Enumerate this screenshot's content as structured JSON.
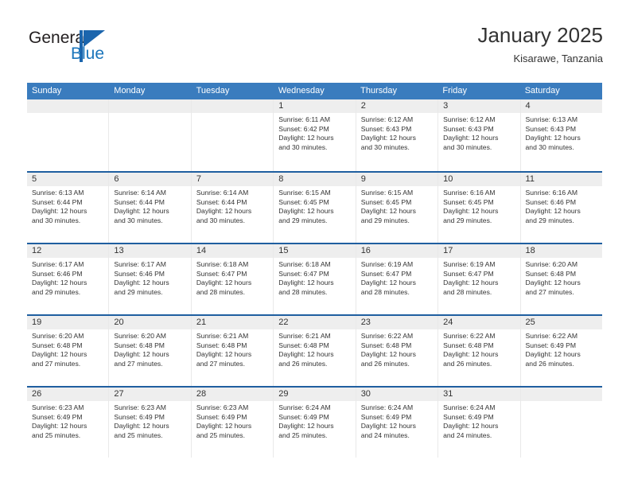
{
  "brand": {
    "name_part1": "General",
    "name_part2": "Blue",
    "flag_icon": "triangle-flag-icon"
  },
  "header": {
    "month_title": "January 2025",
    "location": "Kisarawe, Tanzania"
  },
  "calendar": {
    "weekday_headers": [
      "Sunday",
      "Monday",
      "Tuesday",
      "Wednesday",
      "Thursday",
      "Friday",
      "Saturday"
    ],
    "accent_color": "#3a7cbe",
    "row_divider_color": "#1f5fa0",
    "day_band_color": "#eeeeee",
    "weeks": [
      [
        {
          "day": "",
          "empty": true
        },
        {
          "day": "",
          "empty": true
        },
        {
          "day": "",
          "empty": true
        },
        {
          "day": "1",
          "sunrise": "Sunrise: 6:11 AM",
          "sunset": "Sunset: 6:42 PM",
          "daylight_line1": "Daylight: 12 hours",
          "daylight_line2": "and 30 minutes."
        },
        {
          "day": "2",
          "sunrise": "Sunrise: 6:12 AM",
          "sunset": "Sunset: 6:43 PM",
          "daylight_line1": "Daylight: 12 hours",
          "daylight_line2": "and 30 minutes."
        },
        {
          "day": "3",
          "sunrise": "Sunrise: 6:12 AM",
          "sunset": "Sunset: 6:43 PM",
          "daylight_line1": "Daylight: 12 hours",
          "daylight_line2": "and 30 minutes."
        },
        {
          "day": "4",
          "sunrise": "Sunrise: 6:13 AM",
          "sunset": "Sunset: 6:43 PM",
          "daylight_line1": "Daylight: 12 hours",
          "daylight_line2": "and 30 minutes."
        }
      ],
      [
        {
          "day": "5",
          "sunrise": "Sunrise: 6:13 AM",
          "sunset": "Sunset: 6:44 PM",
          "daylight_line1": "Daylight: 12 hours",
          "daylight_line2": "and 30 minutes."
        },
        {
          "day": "6",
          "sunrise": "Sunrise: 6:14 AM",
          "sunset": "Sunset: 6:44 PM",
          "daylight_line1": "Daylight: 12 hours",
          "daylight_line2": "and 30 minutes."
        },
        {
          "day": "7",
          "sunrise": "Sunrise: 6:14 AM",
          "sunset": "Sunset: 6:44 PM",
          "daylight_line1": "Daylight: 12 hours",
          "daylight_line2": "and 30 minutes."
        },
        {
          "day": "8",
          "sunrise": "Sunrise: 6:15 AM",
          "sunset": "Sunset: 6:45 PM",
          "daylight_line1": "Daylight: 12 hours",
          "daylight_line2": "and 29 minutes."
        },
        {
          "day": "9",
          "sunrise": "Sunrise: 6:15 AM",
          "sunset": "Sunset: 6:45 PM",
          "daylight_line1": "Daylight: 12 hours",
          "daylight_line2": "and 29 minutes."
        },
        {
          "day": "10",
          "sunrise": "Sunrise: 6:16 AM",
          "sunset": "Sunset: 6:45 PM",
          "daylight_line1": "Daylight: 12 hours",
          "daylight_line2": "and 29 minutes."
        },
        {
          "day": "11",
          "sunrise": "Sunrise: 6:16 AM",
          "sunset": "Sunset: 6:46 PM",
          "daylight_line1": "Daylight: 12 hours",
          "daylight_line2": "and 29 minutes."
        }
      ],
      [
        {
          "day": "12",
          "sunrise": "Sunrise: 6:17 AM",
          "sunset": "Sunset: 6:46 PM",
          "daylight_line1": "Daylight: 12 hours",
          "daylight_line2": "and 29 minutes."
        },
        {
          "day": "13",
          "sunrise": "Sunrise: 6:17 AM",
          "sunset": "Sunset: 6:46 PM",
          "daylight_line1": "Daylight: 12 hours",
          "daylight_line2": "and 29 minutes."
        },
        {
          "day": "14",
          "sunrise": "Sunrise: 6:18 AM",
          "sunset": "Sunset: 6:47 PM",
          "daylight_line1": "Daylight: 12 hours",
          "daylight_line2": "and 28 minutes."
        },
        {
          "day": "15",
          "sunrise": "Sunrise: 6:18 AM",
          "sunset": "Sunset: 6:47 PM",
          "daylight_line1": "Daylight: 12 hours",
          "daylight_line2": "and 28 minutes."
        },
        {
          "day": "16",
          "sunrise": "Sunrise: 6:19 AM",
          "sunset": "Sunset: 6:47 PM",
          "daylight_line1": "Daylight: 12 hours",
          "daylight_line2": "and 28 minutes."
        },
        {
          "day": "17",
          "sunrise": "Sunrise: 6:19 AM",
          "sunset": "Sunset: 6:47 PM",
          "daylight_line1": "Daylight: 12 hours",
          "daylight_line2": "and 28 minutes."
        },
        {
          "day": "18",
          "sunrise": "Sunrise: 6:20 AM",
          "sunset": "Sunset: 6:48 PM",
          "daylight_line1": "Daylight: 12 hours",
          "daylight_line2": "and 27 minutes."
        }
      ],
      [
        {
          "day": "19",
          "sunrise": "Sunrise: 6:20 AM",
          "sunset": "Sunset: 6:48 PM",
          "daylight_line1": "Daylight: 12 hours",
          "daylight_line2": "and 27 minutes."
        },
        {
          "day": "20",
          "sunrise": "Sunrise: 6:20 AM",
          "sunset": "Sunset: 6:48 PM",
          "daylight_line1": "Daylight: 12 hours",
          "daylight_line2": "and 27 minutes."
        },
        {
          "day": "21",
          "sunrise": "Sunrise: 6:21 AM",
          "sunset": "Sunset: 6:48 PM",
          "daylight_line1": "Daylight: 12 hours",
          "daylight_line2": "and 27 minutes."
        },
        {
          "day": "22",
          "sunrise": "Sunrise: 6:21 AM",
          "sunset": "Sunset: 6:48 PM",
          "daylight_line1": "Daylight: 12 hours",
          "daylight_line2": "and 26 minutes."
        },
        {
          "day": "23",
          "sunrise": "Sunrise: 6:22 AM",
          "sunset": "Sunset: 6:48 PM",
          "daylight_line1": "Daylight: 12 hours",
          "daylight_line2": "and 26 minutes."
        },
        {
          "day": "24",
          "sunrise": "Sunrise: 6:22 AM",
          "sunset": "Sunset: 6:48 PM",
          "daylight_line1": "Daylight: 12 hours",
          "daylight_line2": "and 26 minutes."
        },
        {
          "day": "25",
          "sunrise": "Sunrise: 6:22 AM",
          "sunset": "Sunset: 6:49 PM",
          "daylight_line1": "Daylight: 12 hours",
          "daylight_line2": "and 26 minutes."
        }
      ],
      [
        {
          "day": "26",
          "sunrise": "Sunrise: 6:23 AM",
          "sunset": "Sunset: 6:49 PM",
          "daylight_line1": "Daylight: 12 hours",
          "daylight_line2": "and 25 minutes."
        },
        {
          "day": "27",
          "sunrise": "Sunrise: 6:23 AM",
          "sunset": "Sunset: 6:49 PM",
          "daylight_line1": "Daylight: 12 hours",
          "daylight_line2": "and 25 minutes."
        },
        {
          "day": "28",
          "sunrise": "Sunrise: 6:23 AM",
          "sunset": "Sunset: 6:49 PM",
          "daylight_line1": "Daylight: 12 hours",
          "daylight_line2": "and 25 minutes."
        },
        {
          "day": "29",
          "sunrise": "Sunrise: 6:24 AM",
          "sunset": "Sunset: 6:49 PM",
          "daylight_line1": "Daylight: 12 hours",
          "daylight_line2": "and 25 minutes."
        },
        {
          "day": "30",
          "sunrise": "Sunrise: 6:24 AM",
          "sunset": "Sunset: 6:49 PM",
          "daylight_line1": "Daylight: 12 hours",
          "daylight_line2": "and 24 minutes."
        },
        {
          "day": "31",
          "sunrise": "Sunrise: 6:24 AM",
          "sunset": "Sunset: 6:49 PM",
          "daylight_line1": "Daylight: 12 hours",
          "daylight_line2": "and 24 minutes."
        },
        {
          "day": "",
          "empty": true
        }
      ]
    ]
  }
}
